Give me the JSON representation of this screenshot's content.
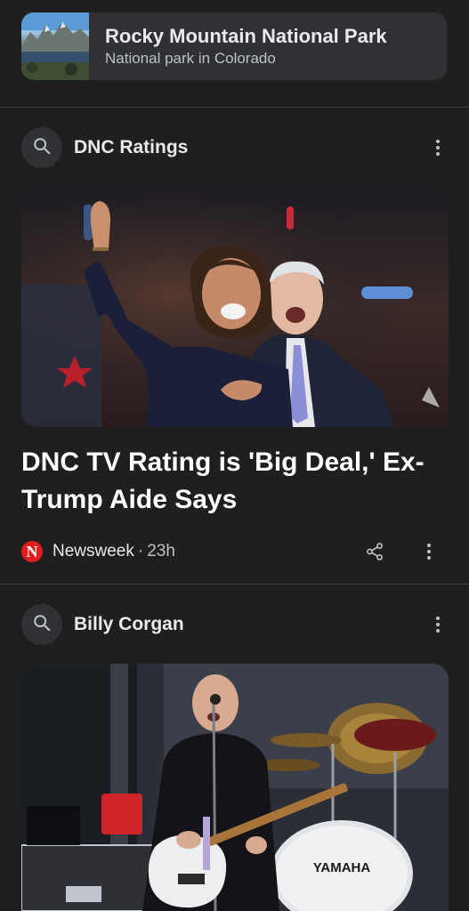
{
  "entity": {
    "title": "Rocky Mountain National Park",
    "subtitle": "National park in Colorado"
  },
  "sections": [
    {
      "query": "DNC Ratings",
      "article": {
        "headline": "DNC TV Rating is 'Big Deal,' Ex-Trump Aide Says",
        "source": "Newsweek",
        "separator": "·",
        "time": "23h",
        "source_logo_letter": "N"
      }
    },
    {
      "query": "Billy Corgan",
      "image_text": "YAMAHA"
    }
  ],
  "colors": {
    "background": "#1f1f1f",
    "card": "#303134",
    "text_primary": "#e8eaed",
    "text_secondary": "#bdc1c6",
    "newsweek_red": "#e11d1d"
  }
}
